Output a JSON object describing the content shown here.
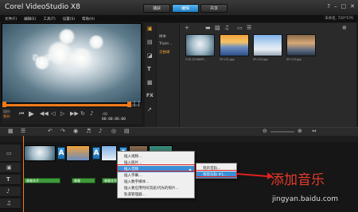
{
  "window": {
    "title": "Corel VideoStudio X8",
    "tabs": [
      {
        "label": "捕获",
        "active": false
      },
      {
        "label": "编辑",
        "active": true
      },
      {
        "label": "共享",
        "active": false
      }
    ],
    "controls": [
      "?",
      "–",
      "□",
      "✕"
    ]
  },
  "menubar": {
    "items": [
      "文件(F)",
      "编辑(E)",
      "工具(T)",
      "设置(S)",
      "帮助(H)"
    ],
    "project_info": "未命名, 720*576"
  },
  "preview": {
    "caption": "春 暖 花 开",
    "project_label": "项目-",
    "clip_label": "素材-",
    "hd_label": "HD",
    "timecode": "00:00:06:00"
  },
  "library": {
    "folders": [
      "样本",
      "Triple...",
      "交换库"
    ],
    "thumbs": [
      {
        "caption": "278-1536699..."
      },
      {
        "caption": "SP-L01.jpg"
      },
      {
        "caption": "SP-L02.jpg"
      },
      {
        "caption": "SP-L03.jpg"
      }
    ],
    "tool_icons": [
      "media-icon",
      "instant-project-icon",
      "transition-icon",
      "title-icon",
      "graphic-icon",
      "fx-filter-icon",
      "path-icon"
    ]
  },
  "timeline": {
    "transition_glyph": "A",
    "title_clips": [
      {
        "label": "春暖花开"
      },
      {
        "label": "春暖"
      },
      {
        "label": "春暖花开"
      }
    ]
  },
  "context_menu": {
    "items": [
      {
        "label": "插入视频...",
        "highlighted": false,
        "submenu": false
      },
      {
        "label": "插入照片...",
        "highlighted": false,
        "submenu": false
      },
      {
        "label": "插入音频",
        "highlighted": true,
        "submenu": true
      },
      {
        "label": "插入字幕...",
        "highlighted": false,
        "submenu": false
      },
      {
        "label": "插入数字媒体...",
        "highlighted": false,
        "submenu": false
      },
      {
        "label": "插入要应用时间流逝/闪光的照片...",
        "highlighted": false,
        "submenu": false
      },
      {
        "label": "轨道管理器...",
        "highlighted": false,
        "submenu": false
      }
    ],
    "submenu": [
      {
        "label": "到声音轨...",
        "highlighted": false
      },
      {
        "label": "到音乐轨 #1...",
        "highlighted": true
      }
    ]
  },
  "annotation": {
    "callout": "添加音乐",
    "highlight_color": "#e02020"
  },
  "watermark": "jingyan.baidu.com"
}
